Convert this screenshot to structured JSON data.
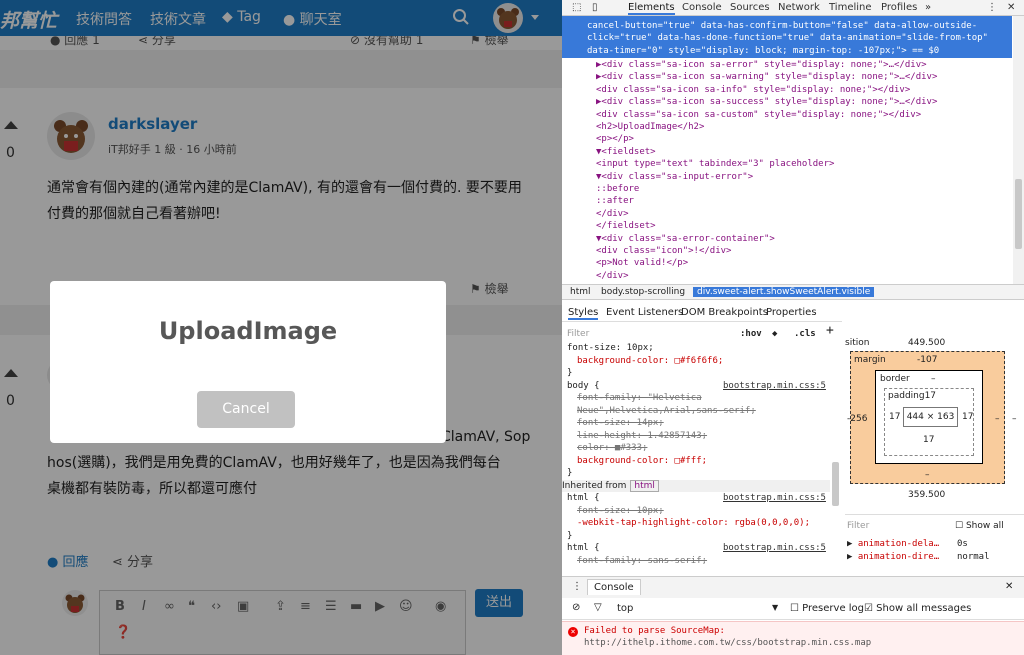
{
  "site": {
    "brand": "邦幫忙",
    "nav": [
      "技術問答",
      "技術文章",
      "Tag",
      "聊天室"
    ],
    "strip": {
      "reply": "回應",
      "reply_count": "1",
      "share": "分享",
      "no_help": "沒有幫助",
      "no_help_count": "1",
      "report": "檢舉"
    },
    "answer1": {
      "votes": "0",
      "user": "darkslayer",
      "meta": "iT邦好手 1 級 ‧ 16 小時前",
      "body": "通常會有個內建的(通常內建的是ClamAV), 有的還會有一個付費的. 要不要用付費的那個就自己看著辦吧!",
      "report": "檢舉"
    },
    "answer2": {
      "votes": "0",
      "line1": "ClamAV, Sop",
      "line2": "hos(選購)，我們是用免費的ClamAV，也用好幾年了，也是因為我們每台",
      "line3": "桌機都有裝防毒，所以都還可應付",
      "reply": "回應",
      "share": "分享"
    },
    "editor": {
      "send": "送出"
    }
  },
  "modal": {
    "title": "UploadImage",
    "cancel": "Cancel"
  },
  "devtools": {
    "tabs": [
      "Elements",
      "Console",
      "Sources",
      "Network",
      "Timeline",
      "Profiles",
      "»"
    ],
    "selected_lines": [
      "cancel-button=\"true\" data-has-confirm-button=\"false\" data-allow-outside-",
      "click=\"true\" data-has-done-function=\"true\" data-animation=\"slide-from-top\"",
      "data-timer=\"0\" style=\"display: block; margin-top: -107px;\"> == $0"
    ],
    "element_lines": [
      "▶<div class=\"sa-icon sa-error\" style=\"display: none;\">…</div>",
      "▶<div class=\"sa-icon sa-warning\" style=\"display: none;\">…</div>",
      "<div class=\"sa-icon sa-info\" style=\"display: none;\"></div>",
      "▶<div class=\"sa-icon sa-success\" style=\"display: none;\">…</div>",
      "<div class=\"sa-icon sa-custom\" style=\"display: none;\"></div>",
      "<h2>UploadImage</h2>",
      "<p></p>",
      "▼<fieldset>",
      "  <input type=\"text\" tabindex=\"3\" placeholder>",
      "  ▼<div class=\"sa-input-error\">",
      "      ::before",
      "      ::after",
      "    </div>",
      "</fieldset>",
      "▼<div class=\"sa-error-container\">",
      "  <div class=\"icon\">!</div>",
      "  <p>Not valid!</p>",
      "</div>"
    ],
    "breadcrumbs": [
      "html",
      "body.stop-scrolling",
      "div.sweet-alert.showSweetAlert.visible"
    ],
    "subtabs": [
      "Styles",
      "Event Listeners",
      "DOM Breakpoints",
      "Properties"
    ],
    "filter_placeholder": "Filter",
    "hov": ":hov",
    "cls": ".cls",
    "style_lines": [
      "font-size: 10px;",
      "background-color: □#f6f6f6;",
      "}",
      "body {",
      "font-family: \"Helvetica",
      "Neue\",Helvetica,Arial,sans-serif;",
      "font-size: 14px;",
      "line-height: 1.42857143;",
      "color: ■#333;",
      "background-color: □#fff;",
      "}",
      "Inherited from",
      "html {",
      "font-size: 10px;",
      "-webkit-tap-highlight-color: rgba(0,0,0,0);",
      "}",
      "html {",
      "font-family: sans-serif;"
    ],
    "source": "bootstrap.min.css:5",
    "inherited_tag": "html",
    "box": {
      "position": "sition",
      "pos_top": "449.500",
      "margin_label": "margin",
      "margin_top": "-107",
      "margin_left": "-256",
      "margin_right": "–",
      "margin_bottom": "–",
      "border_label": "border",
      "border_val": "–",
      "padding_label": "padding17",
      "pad_left": "17",
      "pad_right": "17",
      "pad_bottom": "17",
      "content": "444 × 163",
      "dash": "–",
      "pos_bottom": "359.500"
    },
    "computed_filter": "Filter",
    "show_all": "Show all",
    "computed_props": [
      {
        "name": "animation-dela…",
        "value": "0s"
      },
      {
        "name": "animation-dire…",
        "value": "normal"
      }
    ],
    "console_tab": "Console",
    "context": "top",
    "preserve_log": "Preserve log",
    "show_all_messages": "Show all messages",
    "error_line1": "Failed to parse SourceMap:",
    "error_line2": "http://ithelp.ithome.com.tw/css/bootstrap.min.css.map"
  },
  "colors": {
    "brand": "#1e7ec8",
    "selection": "#3879d9",
    "error": "#cc0000"
  }
}
